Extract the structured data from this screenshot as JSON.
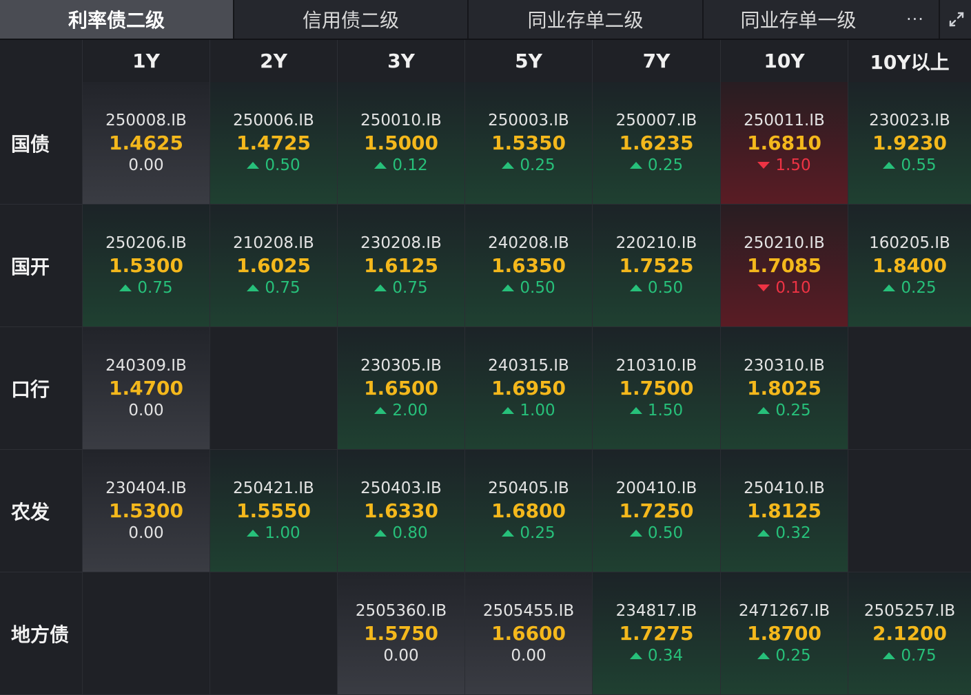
{
  "tabs": [
    "利率债二级",
    "信用债二级",
    "同业存单二级",
    "同业存单一级"
  ],
  "more_label": "···",
  "columns": [
    "1Y",
    "2Y",
    "3Y",
    "5Y",
    "7Y",
    "10Y",
    "10Y以上"
  ],
  "rows": [
    {
      "label": "国债",
      "cells": [
        {
          "code": "250008.IB",
          "yield": "1.4625",
          "change": "0.00",
          "dir": "flat"
        },
        {
          "code": "250006.IB",
          "yield": "1.4725",
          "change": "0.50",
          "dir": "up"
        },
        {
          "code": "250010.IB",
          "yield": "1.5000",
          "change": "0.12",
          "dir": "up"
        },
        {
          "code": "250003.IB",
          "yield": "1.5350",
          "change": "0.25",
          "dir": "up"
        },
        {
          "code": "250007.IB",
          "yield": "1.6235",
          "change": "0.25",
          "dir": "up"
        },
        {
          "code": "250011.IB",
          "yield": "1.6810",
          "change": "1.50",
          "dir": "down"
        },
        {
          "code": "230023.IB",
          "yield": "1.9230",
          "change": "0.55",
          "dir": "up"
        }
      ]
    },
    {
      "label": "国开",
      "cells": [
        {
          "code": "250206.IB",
          "yield": "1.5300",
          "change": "0.75",
          "dir": "up"
        },
        {
          "code": "210208.IB",
          "yield": "1.6025",
          "change": "0.75",
          "dir": "up"
        },
        {
          "code": "230208.IB",
          "yield": "1.6125",
          "change": "0.75",
          "dir": "up"
        },
        {
          "code": "240208.IB",
          "yield": "1.6350",
          "change": "0.50",
          "dir": "up"
        },
        {
          "code": "220210.IB",
          "yield": "1.7525",
          "change": "0.50",
          "dir": "up"
        },
        {
          "code": "250210.IB",
          "yield": "1.7085",
          "change": "0.10",
          "dir": "down"
        },
        {
          "code": "160205.IB",
          "yield": "1.8400",
          "change": "0.25",
          "dir": "up"
        }
      ]
    },
    {
      "label": "口行",
      "cells": [
        {
          "code": "240309.IB",
          "yield": "1.4700",
          "change": "0.00",
          "dir": "flat"
        },
        null,
        {
          "code": "230305.IB",
          "yield": "1.6500",
          "change": "2.00",
          "dir": "up"
        },
        {
          "code": "240315.IB",
          "yield": "1.6950",
          "change": "1.00",
          "dir": "up"
        },
        {
          "code": "210310.IB",
          "yield": "1.7500",
          "change": "1.50",
          "dir": "up"
        },
        {
          "code": "230310.IB",
          "yield": "1.8025",
          "change": "0.25",
          "dir": "up"
        },
        null
      ]
    },
    {
      "label": "农发",
      "cells": [
        {
          "code": "230404.IB",
          "yield": "1.5300",
          "change": "0.00",
          "dir": "flat"
        },
        {
          "code": "250421.IB",
          "yield": "1.5550",
          "change": "1.00",
          "dir": "up"
        },
        {
          "code": "250403.IB",
          "yield": "1.6330",
          "change": "0.80",
          "dir": "up"
        },
        {
          "code": "250405.IB",
          "yield": "1.6800",
          "change": "0.25",
          "dir": "up"
        },
        {
          "code": "200410.IB",
          "yield": "1.7250",
          "change": "0.50",
          "dir": "up"
        },
        {
          "code": "250410.IB",
          "yield": "1.8125",
          "change": "0.32",
          "dir": "up"
        },
        null
      ]
    },
    {
      "label": "地方债",
      "cells": [
        null,
        null,
        {
          "code": "2505360.IB",
          "yield": "1.5750",
          "change": "0.00",
          "dir": "flat"
        },
        {
          "code": "2505455.IB",
          "yield": "1.6600",
          "change": "0.00",
          "dir": "flat"
        },
        {
          "code": "234817.IB",
          "yield": "1.7275",
          "change": "0.34",
          "dir": "up"
        },
        {
          "code": "2471267.IB",
          "yield": "1.8700",
          "change": "0.25",
          "dir": "up"
        },
        {
          "code": "2505257.IB",
          "yield": "2.1200",
          "change": "0.75",
          "dir": "up"
        }
      ]
    }
  ]
}
